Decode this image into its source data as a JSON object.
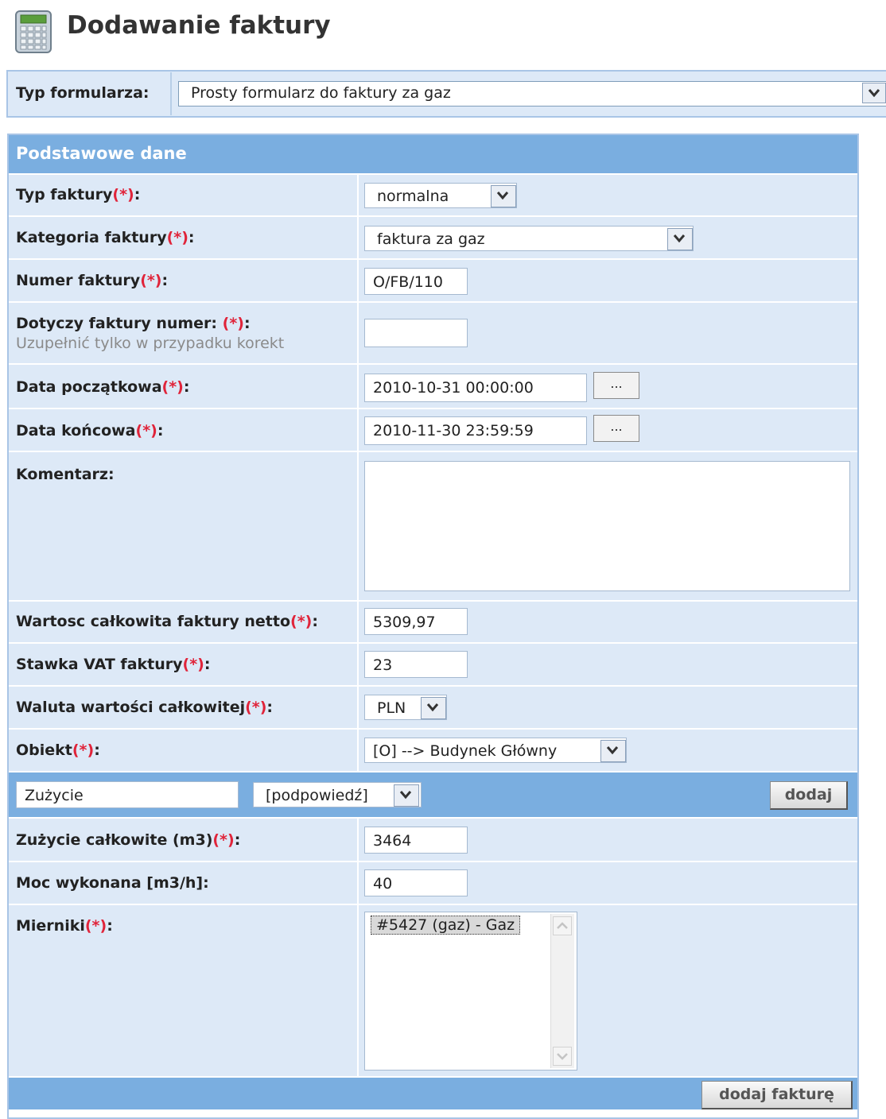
{
  "header": {
    "title": "Dodawanie faktury",
    "icon": "calculator-icon"
  },
  "form_type": {
    "label": "Typ formularza:",
    "value": "Prosty formularz do faktury za gaz"
  },
  "section": {
    "title": "Podstawowe dane"
  },
  "fields": {
    "invoice_type": {
      "label": "Typ faktury",
      "req": "(*)",
      "colon": ":",
      "value": "normalna"
    },
    "category": {
      "label": "Kategoria faktury",
      "req": "(*)",
      "colon": ":",
      "value": "faktura za gaz"
    },
    "number": {
      "label": "Numer faktury",
      "req": "(*)",
      "colon": ":",
      "value": "O/FB/110"
    },
    "ref_number": {
      "label": "Dotyczy faktury numer: ",
      "req": "(*)",
      "colon": ":",
      "hint": "Uzupełnić tylko w przypadku korekt",
      "value": ""
    },
    "start_date": {
      "label": "Data początkowa",
      "req": "(*)",
      "colon": ":",
      "value": "2010-10-31 00:00:00",
      "button": "..."
    },
    "end_date": {
      "label": "Data końcowa",
      "req": "(*)",
      "colon": ":",
      "value": "2010-11-30 23:59:59",
      "button": "..."
    },
    "comment": {
      "label": "Komentarz:",
      "value": ""
    },
    "net_value": {
      "label": "Wartosc całkowita faktury netto",
      "req": "(*)",
      "colon": ":",
      "value": "5309,97"
    },
    "vat": {
      "label": "Stawka VAT faktury",
      "req": "(*)",
      "colon": ":",
      "value": "23"
    },
    "currency": {
      "label": "Waluta wartości całkowitej",
      "req": "(*)",
      "colon": ":",
      "value": "PLN"
    },
    "object": {
      "label": "Obiekt",
      "req": "(*)",
      "colon": ":",
      "value": "[O] --> Budynek Główny"
    }
  },
  "usage_bar": {
    "input_value": "Zużycie",
    "hint_select": "[podpowiedź]",
    "add_button": "dodaj"
  },
  "usage_fields": {
    "total": {
      "label": "Zużycie całkowite (m3)",
      "req": "(*)",
      "colon": ":",
      "value": "3464"
    },
    "power": {
      "label": "Moc wykonana [m3/h]:",
      "value": "40"
    },
    "meters": {
      "label": "Mierniki",
      "req": "(*)",
      "colon": ":",
      "items": [
        "#5427 (gaz) - Gaz"
      ]
    }
  },
  "footer": {
    "submit_button": "dodaj fakturę"
  }
}
